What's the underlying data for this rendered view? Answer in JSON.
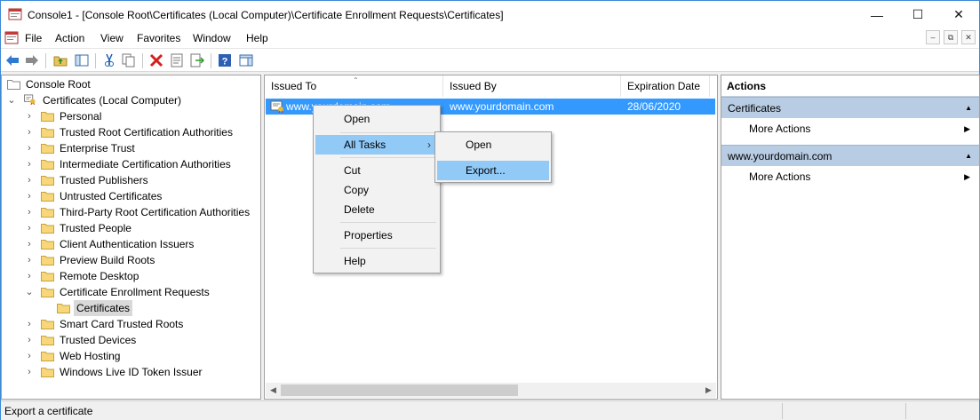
{
  "window": {
    "title": "Console1 - [Console Root\\Certificates (Local Computer)\\Certificate Enrollment Requests\\Certificates]",
    "minimize": "—",
    "maximize": "☐",
    "close": "✕"
  },
  "menubar": {
    "items": [
      "File",
      "Action",
      "View",
      "Favorites",
      "Window",
      "Help"
    ],
    "mdi": [
      "–",
      "⧉",
      "✕"
    ]
  },
  "toolbar": {
    "icons": [
      "back-icon",
      "forward-icon",
      "up-folder-icon",
      "show-hide-tree-icon",
      "cut-icon",
      "copy-icon",
      "delete-icon",
      "properties-icon",
      "export-list-icon",
      "help-icon",
      "show-hide-action-pane-icon"
    ]
  },
  "tree": {
    "root": "Console Root",
    "computer": "Certificates (Local Computer)",
    "folders": [
      "Personal",
      "Trusted Root Certification Authorities",
      "Enterprise Trust",
      "Intermediate Certification Authorities",
      "Trusted Publishers",
      "Untrusted Certificates",
      "Third-Party Root Certification Authorities",
      "Trusted People",
      "Client Authentication Issuers",
      "Preview Build Roots",
      "Remote Desktop",
      "Certificate Enrollment Requests",
      "Certificates",
      "Smart Card Trusted Roots",
      "Trusted Devices",
      "Web Hosting",
      "Windows Live ID Token Issuer"
    ]
  },
  "list": {
    "columns": [
      "Issued To",
      "Issued By",
      "Expiration Date"
    ],
    "rows": [
      {
        "issued_to": "www.yourdomain.com",
        "issued_by": "www.yourdomain.com",
        "expiration": "28/06/2020"
      }
    ]
  },
  "actions": {
    "header": "Actions",
    "sections": [
      {
        "title": "Certificates",
        "item": "More Actions"
      },
      {
        "title": "www.yourdomain.com",
        "item": "More Actions"
      }
    ]
  },
  "context_menu": {
    "open": "Open",
    "all_tasks": "All Tasks",
    "cut": "Cut",
    "copy": "Copy",
    "delete": "Delete",
    "properties": "Properties",
    "help": "Help"
  },
  "submenu": {
    "open": "Open",
    "export": "Export..."
  },
  "status": {
    "text": "Export a certificate"
  },
  "colors": {
    "selection": "#3399ff",
    "menu_highlight": "#91c9f7",
    "action_section": "#b8cce4"
  }
}
